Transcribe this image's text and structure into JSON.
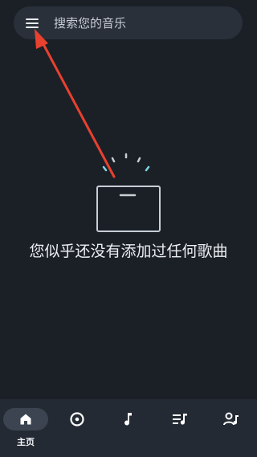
{
  "search": {
    "placeholder": "搜索您的音乐",
    "menu_icon": "hamburger-menu-icon"
  },
  "empty_state": {
    "icon": "empty-box-icon",
    "message": "您似乎还没有添加过任何歌曲"
  },
  "bottom_nav": {
    "items": [
      {
        "label": "主页",
        "icon": "home-icon",
        "active": true
      },
      {
        "label": "",
        "icon": "album-disc-icon",
        "active": false
      },
      {
        "label": "",
        "icon": "music-note-icon",
        "active": false
      },
      {
        "label": "",
        "icon": "playlist-icon",
        "active": false
      },
      {
        "label": "",
        "icon": "artist-icon",
        "active": false
      }
    ]
  },
  "colors": {
    "background": "#1b2027",
    "search_bar": "#29303a",
    "nav_bar": "#232a33",
    "annotation_arrow": "#e8412f",
    "illustration_accent": "#7fd3e6"
  }
}
